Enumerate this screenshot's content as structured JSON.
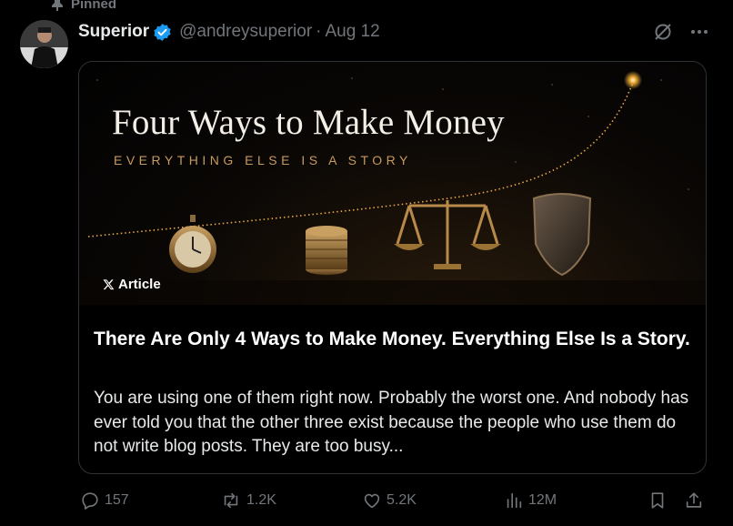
{
  "pinned": {
    "label": "Pinned"
  },
  "author": {
    "name": "Superior",
    "handle": "@andreysuperior",
    "separator": "·",
    "date": "Aug 12"
  },
  "card": {
    "image": {
      "title": "Four Ways to Make Money",
      "subtitle": "EVERYTHING ELSE IS A STORY"
    },
    "tag": "Article",
    "title": "There Are Only 4 Ways to Make Money. Everything Else Is a Story.",
    "description": "You are using one of them right now. Probably the worst one. And nobody has ever told you that the other three exist because the people who use them do not write blog posts. They are too busy..."
  },
  "actions": {
    "replies": "157",
    "reposts": "1.2K",
    "likes": "5.2K",
    "views": "12M"
  },
  "colors": {
    "background": "#000000",
    "text": "#e7e9ea",
    "muted": "#71767b",
    "verified": "#1d9bf0",
    "card_border": "#2f3336",
    "accent_gold": "#c79a5e"
  },
  "icons": {
    "pinned": "pin-icon",
    "verified": "verified-badge-icon",
    "grok": "grok-icon",
    "more": "more-icon",
    "x_logo": "x-logo-icon",
    "reply": "reply-icon",
    "repost": "repost-icon",
    "like": "like-icon",
    "views": "views-icon",
    "bookmark": "bookmark-icon",
    "share": "share-icon"
  }
}
